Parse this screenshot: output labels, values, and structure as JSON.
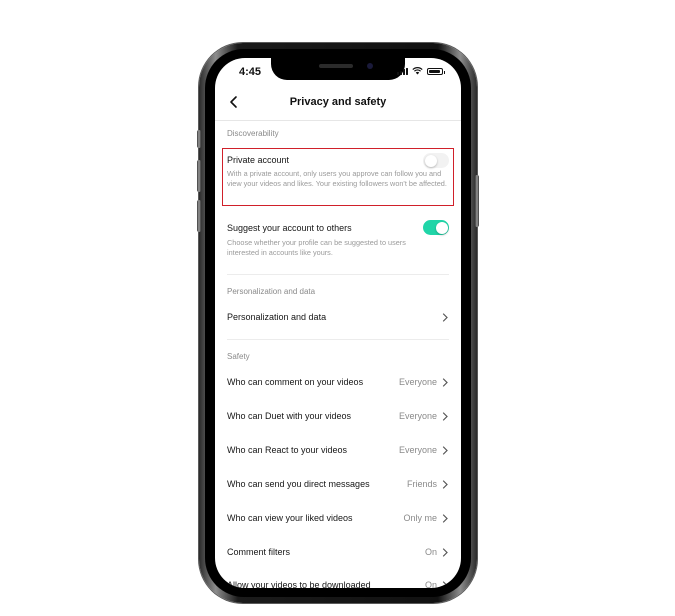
{
  "status_bar": {
    "time": "4:45"
  },
  "nav": {
    "title": "Privacy and safety"
  },
  "discoverability": {
    "heading": "Discoverability",
    "private_account": {
      "title": "Private account",
      "description": "With a private account, only users you approve can follow you and view your videos and likes. Your existing followers won't be affected.",
      "enabled": false
    },
    "suggest_account": {
      "title": "Suggest your account to others",
      "description": "Choose whether your profile can be suggested to users interested in accounts like yours.",
      "enabled": true
    }
  },
  "personalization": {
    "heading": "Personalization and data",
    "item_label": "Personalization and data"
  },
  "safety": {
    "heading": "Safety",
    "items": [
      {
        "label": "Who can comment on your videos",
        "value": "Everyone"
      },
      {
        "label": "Who can Duet with your videos",
        "value": "Everyone"
      },
      {
        "label": "Who can React to your videos",
        "value": "Everyone"
      },
      {
        "label": "Who can send you direct messages",
        "value": "Friends"
      },
      {
        "label": "Who can view your liked videos",
        "value": "Only me"
      },
      {
        "label": "Comment filters",
        "value": "On"
      },
      {
        "label": "Allow your videos to be downloaded",
        "value": "On"
      }
    ]
  },
  "colors": {
    "toggle_on": "#20d5a8",
    "highlight_border": "#d0202a"
  },
  "icons": {
    "back": "chevron-left-icon",
    "row": "chevron-right-icon"
  }
}
